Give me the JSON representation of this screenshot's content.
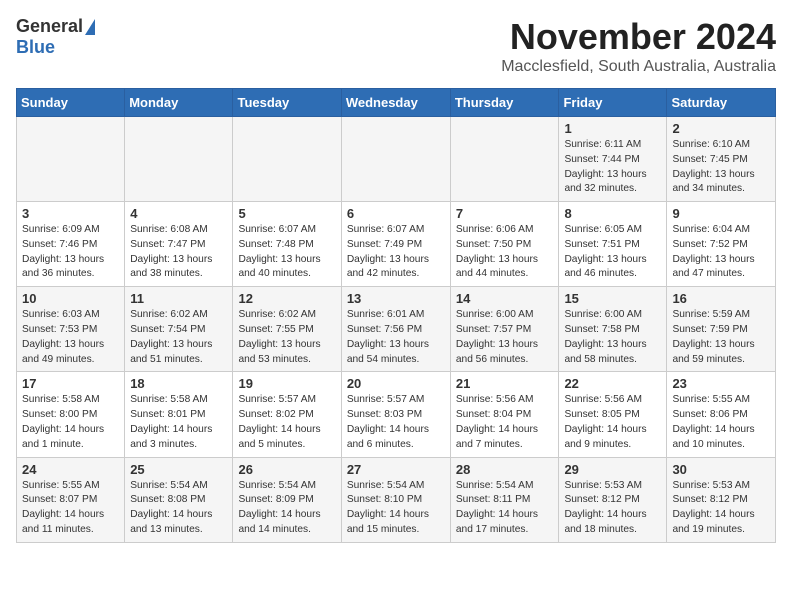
{
  "header": {
    "logo_general": "General",
    "logo_blue": "Blue",
    "month_title": "November 2024",
    "location": "Macclesfield, South Australia, Australia"
  },
  "weekdays": [
    "Sunday",
    "Monday",
    "Tuesday",
    "Wednesday",
    "Thursday",
    "Friday",
    "Saturday"
  ],
  "weeks": [
    [
      {
        "day": "",
        "info": ""
      },
      {
        "day": "",
        "info": ""
      },
      {
        "day": "",
        "info": ""
      },
      {
        "day": "",
        "info": ""
      },
      {
        "day": "",
        "info": ""
      },
      {
        "day": "1",
        "info": "Sunrise: 6:11 AM\nSunset: 7:44 PM\nDaylight: 13 hours\nand 32 minutes."
      },
      {
        "day": "2",
        "info": "Sunrise: 6:10 AM\nSunset: 7:45 PM\nDaylight: 13 hours\nand 34 minutes."
      }
    ],
    [
      {
        "day": "3",
        "info": "Sunrise: 6:09 AM\nSunset: 7:46 PM\nDaylight: 13 hours\nand 36 minutes."
      },
      {
        "day": "4",
        "info": "Sunrise: 6:08 AM\nSunset: 7:47 PM\nDaylight: 13 hours\nand 38 minutes."
      },
      {
        "day": "5",
        "info": "Sunrise: 6:07 AM\nSunset: 7:48 PM\nDaylight: 13 hours\nand 40 minutes."
      },
      {
        "day": "6",
        "info": "Sunrise: 6:07 AM\nSunset: 7:49 PM\nDaylight: 13 hours\nand 42 minutes."
      },
      {
        "day": "7",
        "info": "Sunrise: 6:06 AM\nSunset: 7:50 PM\nDaylight: 13 hours\nand 44 minutes."
      },
      {
        "day": "8",
        "info": "Sunrise: 6:05 AM\nSunset: 7:51 PM\nDaylight: 13 hours\nand 46 minutes."
      },
      {
        "day": "9",
        "info": "Sunrise: 6:04 AM\nSunset: 7:52 PM\nDaylight: 13 hours\nand 47 minutes."
      }
    ],
    [
      {
        "day": "10",
        "info": "Sunrise: 6:03 AM\nSunset: 7:53 PM\nDaylight: 13 hours\nand 49 minutes."
      },
      {
        "day": "11",
        "info": "Sunrise: 6:02 AM\nSunset: 7:54 PM\nDaylight: 13 hours\nand 51 minutes."
      },
      {
        "day": "12",
        "info": "Sunrise: 6:02 AM\nSunset: 7:55 PM\nDaylight: 13 hours\nand 53 minutes."
      },
      {
        "day": "13",
        "info": "Sunrise: 6:01 AM\nSunset: 7:56 PM\nDaylight: 13 hours\nand 54 minutes."
      },
      {
        "day": "14",
        "info": "Sunrise: 6:00 AM\nSunset: 7:57 PM\nDaylight: 13 hours\nand 56 minutes."
      },
      {
        "day": "15",
        "info": "Sunrise: 6:00 AM\nSunset: 7:58 PM\nDaylight: 13 hours\nand 58 minutes."
      },
      {
        "day": "16",
        "info": "Sunrise: 5:59 AM\nSunset: 7:59 PM\nDaylight: 13 hours\nand 59 minutes."
      }
    ],
    [
      {
        "day": "17",
        "info": "Sunrise: 5:58 AM\nSunset: 8:00 PM\nDaylight: 14 hours\nand 1 minute."
      },
      {
        "day": "18",
        "info": "Sunrise: 5:58 AM\nSunset: 8:01 PM\nDaylight: 14 hours\nand 3 minutes."
      },
      {
        "day": "19",
        "info": "Sunrise: 5:57 AM\nSunset: 8:02 PM\nDaylight: 14 hours\nand 5 minutes."
      },
      {
        "day": "20",
        "info": "Sunrise: 5:57 AM\nSunset: 8:03 PM\nDaylight: 14 hours\nand 6 minutes."
      },
      {
        "day": "21",
        "info": "Sunrise: 5:56 AM\nSunset: 8:04 PM\nDaylight: 14 hours\nand 7 minutes."
      },
      {
        "day": "22",
        "info": "Sunrise: 5:56 AM\nSunset: 8:05 PM\nDaylight: 14 hours\nand 9 minutes."
      },
      {
        "day": "23",
        "info": "Sunrise: 5:55 AM\nSunset: 8:06 PM\nDaylight: 14 hours\nand 10 minutes."
      }
    ],
    [
      {
        "day": "24",
        "info": "Sunrise: 5:55 AM\nSunset: 8:07 PM\nDaylight: 14 hours\nand 11 minutes."
      },
      {
        "day": "25",
        "info": "Sunrise: 5:54 AM\nSunset: 8:08 PM\nDaylight: 14 hours\nand 13 minutes."
      },
      {
        "day": "26",
        "info": "Sunrise: 5:54 AM\nSunset: 8:09 PM\nDaylight: 14 hours\nand 14 minutes."
      },
      {
        "day": "27",
        "info": "Sunrise: 5:54 AM\nSunset: 8:10 PM\nDaylight: 14 hours\nand 15 minutes."
      },
      {
        "day": "28",
        "info": "Sunrise: 5:54 AM\nSunset: 8:11 PM\nDaylight: 14 hours\nand 17 minutes."
      },
      {
        "day": "29",
        "info": "Sunrise: 5:53 AM\nSunset: 8:12 PM\nDaylight: 14 hours\nand 18 minutes."
      },
      {
        "day": "30",
        "info": "Sunrise: 5:53 AM\nSunset: 8:12 PM\nDaylight: 14 hours\nand 19 minutes."
      }
    ]
  ]
}
